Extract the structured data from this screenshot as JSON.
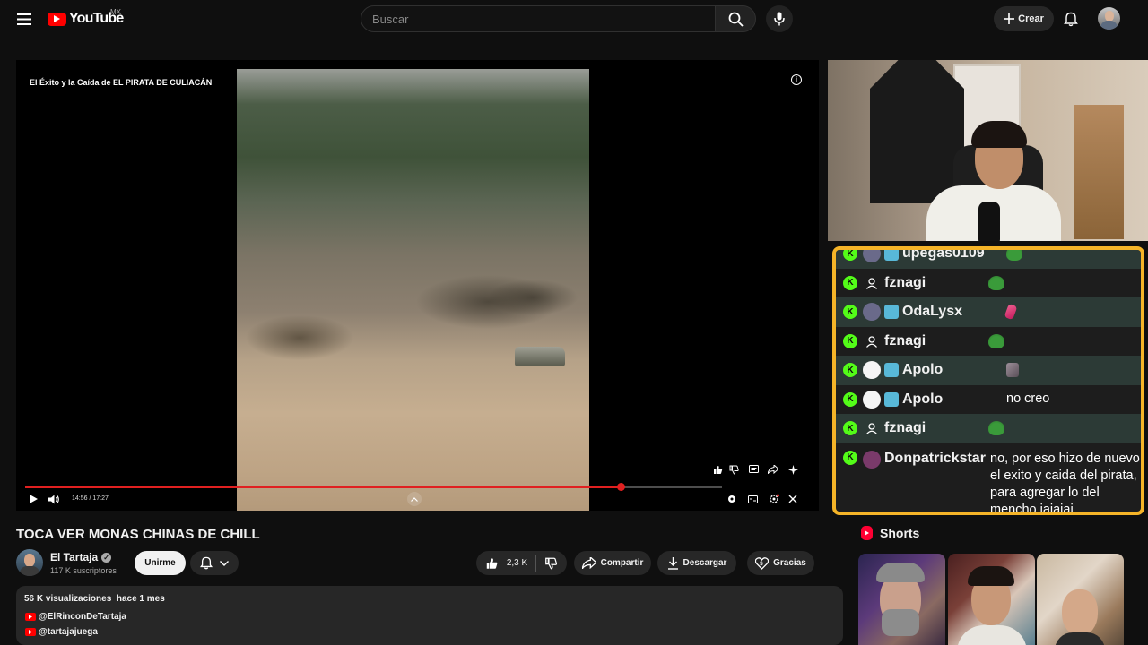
{
  "header": {
    "logo_text": "YouTube",
    "country": "MX",
    "search_placeholder": "Buscar",
    "create_label": "Crear"
  },
  "player": {
    "video_title_overlay": "El Éxito y la Caída de EL PIRATA DE CULIACÁN",
    "time_display": "14:56 / 17:27",
    "progress": 0.855
  },
  "chat": {
    "messages": [
      {
        "user": "upegas0109",
        "text": "",
        "emote": "pepe",
        "badge": "sub"
      },
      {
        "user": "fznagi",
        "text": "",
        "emote": "pepe",
        "badge": "none"
      },
      {
        "user": "OdaLysx",
        "text": "",
        "emote": "pink",
        "badge": "sub"
      },
      {
        "user": "fznagi",
        "text": "",
        "emote": "pepe",
        "badge": "none"
      },
      {
        "user": "Apolo",
        "text": "",
        "emote": "rock",
        "badge": "sub"
      },
      {
        "user": "Apolo",
        "text": "no creo",
        "emote": "",
        "badge": "sub"
      },
      {
        "user": "fznagi",
        "text": "",
        "emote": "pepe",
        "badge": "none"
      },
      {
        "user": "Donpatrickstar",
        "text": "no, por eso hizo de nuevo el exito y caida del pirata, para agregar lo del mencho jajajaj",
        "emote": "",
        "badge": "none"
      }
    ],
    "badge_letter": "K"
  },
  "video": {
    "title": "TOCA VER MONAS CHINAS DE CHILL",
    "channel_name": "El Tartaja",
    "subscribers": "117 K suscriptores",
    "join_label": "Unirme",
    "likes": "2,3 K",
    "share_label": "Compartir",
    "download_label": "Descargar",
    "thanks_label": "Gracias"
  },
  "description": {
    "views": "56 K visualizaciones",
    "age": "hace 1 mes",
    "links": [
      "@ElRinconDeTartaja",
      "@tartajajuega"
    ]
  },
  "shorts": {
    "heading": "Shorts"
  },
  "colors": {
    "background": "#0f0f0f",
    "accent_red": "#ff0000",
    "chat_border": "#f5b428",
    "kick_green": "#53fc18"
  }
}
